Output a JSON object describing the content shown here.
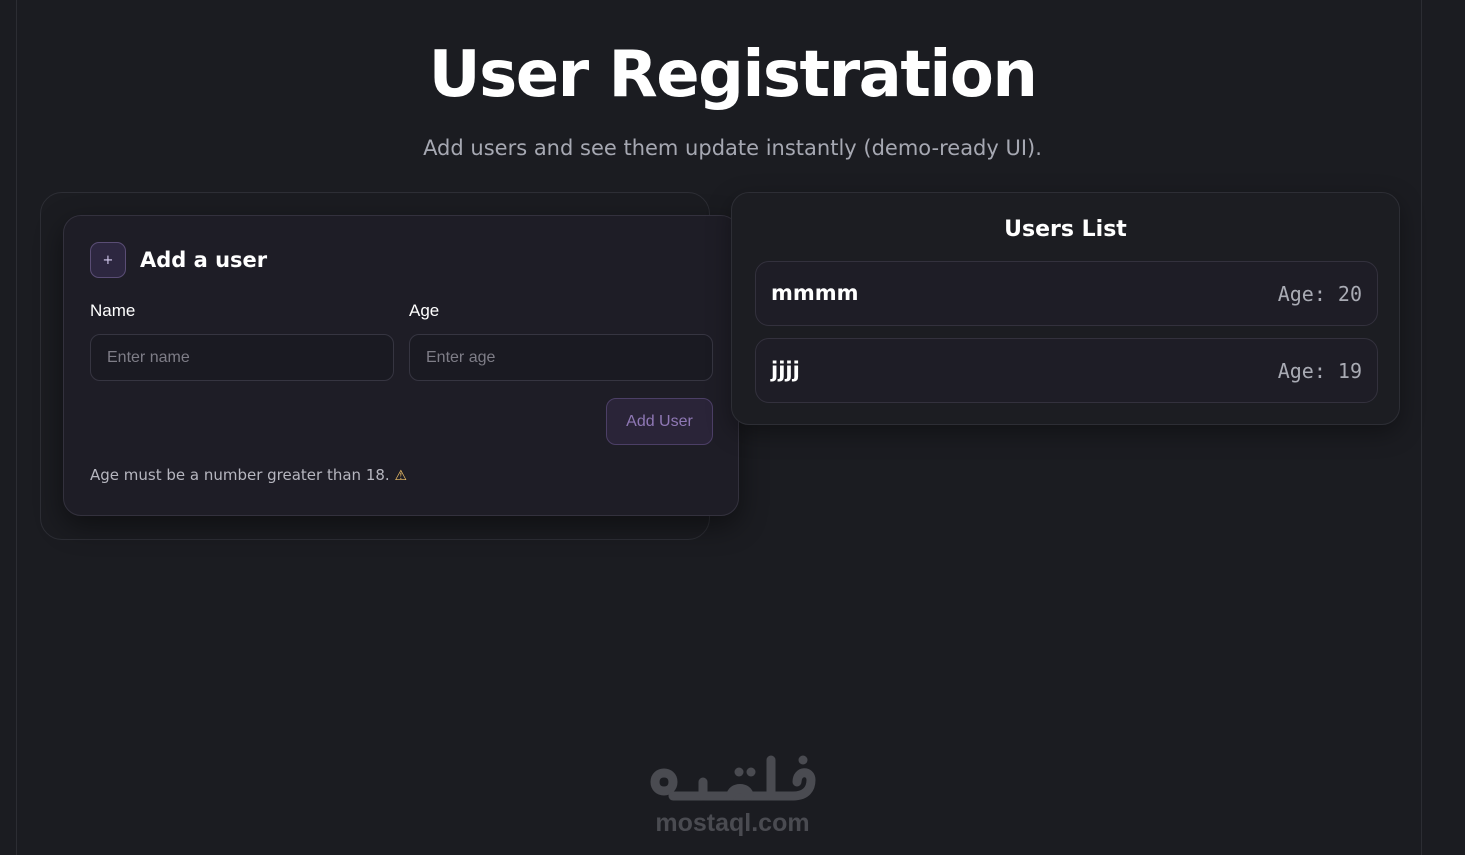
{
  "header": {
    "title": "User Registration",
    "subtitle": "Add users and see them update instantly (demo-ready UI)."
  },
  "form": {
    "icon": "plus-icon",
    "icon_glyph": "+",
    "title": "Add a user",
    "name_label": "Name",
    "name_placeholder": "Enter name",
    "name_value": "",
    "age_label": "Age",
    "age_placeholder": "Enter age",
    "age_value": "",
    "submit_label": "Add User",
    "hint": "Age must be a number greater than 18.",
    "hint_icon": "warning-icon",
    "hint_glyph": "⚠"
  },
  "users": {
    "title": "Users List",
    "items": [
      {
        "name": "mmmm",
        "age": "Age: 20"
      },
      {
        "name": "jjjj",
        "age": "Age: 19"
      }
    ]
  },
  "watermark": {
    "text": "mostaql.com",
    "mark": "مستقل",
    "color": "#4a4b51"
  }
}
